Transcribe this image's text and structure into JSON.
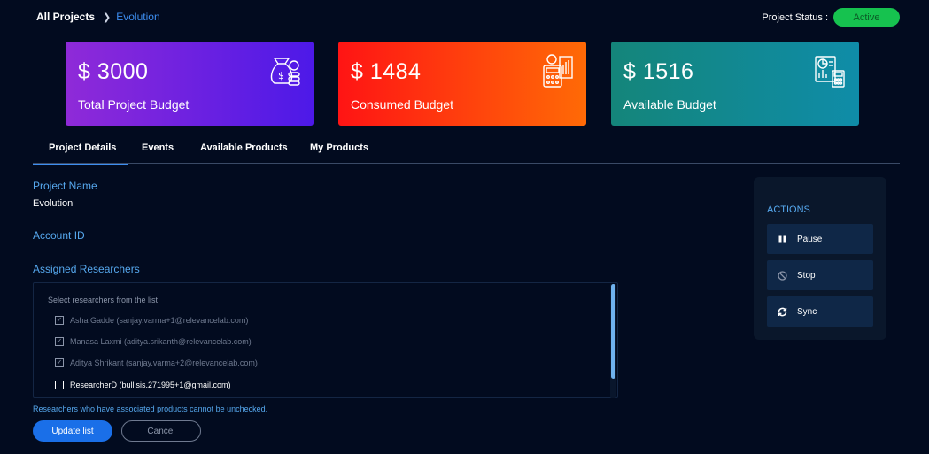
{
  "breadcrumb": {
    "root": "All Projects",
    "current": "Evolution"
  },
  "status": {
    "label": "Project Status :",
    "value": "Active",
    "color": "#16c24f"
  },
  "cards": [
    {
      "amount": "$ 3000",
      "label": "Total Project Budget",
      "icon": "money-bag-icon"
    },
    {
      "amount": "$ 1484",
      "label": "Consumed Budget",
      "icon": "calculator-chart-icon"
    },
    {
      "amount": "$ 1516",
      "label": "Available Budget",
      "icon": "budget-report-icon"
    }
  ],
  "tabs": [
    {
      "label": "Project Details",
      "active": true
    },
    {
      "label": "Events",
      "active": false
    },
    {
      "label": "Available Products",
      "active": false
    },
    {
      "label": "My Products",
      "active": false
    }
  ],
  "fields": {
    "project_name_label": "Project Name",
    "project_name_value": "Evolution",
    "account_id_label": "Account ID",
    "assigned_label": "Assigned Researchers"
  },
  "researchers": {
    "hint": "Select researchers from the list",
    "items": [
      {
        "name": "Asha Gadde (sanjay.varma+1@relevancelab.com)",
        "checked": true,
        "disabled": true
      },
      {
        "name": "Manasa Laxmi (aditya.srikanth@relevancelab.com)",
        "checked": true,
        "disabled": true
      },
      {
        "name": "Aditya Shrikant (sanjay.varma+2@relevancelab.com)",
        "checked": true,
        "disabled": true
      },
      {
        "name": "ResearcherD (bullisis.271995+1@gmail.com)",
        "checked": false,
        "disabled": false
      }
    ],
    "note": "Researchers who have associated products cannot be unchecked."
  },
  "buttons": {
    "update": "Update list",
    "cancel": "Cancel"
  },
  "actions": {
    "title": "ACTIONS",
    "items": [
      {
        "label": "Pause",
        "icon": "pause-icon"
      },
      {
        "label": "Stop",
        "icon": "stop-icon"
      },
      {
        "label": "Sync",
        "icon": "sync-icon"
      }
    ]
  }
}
